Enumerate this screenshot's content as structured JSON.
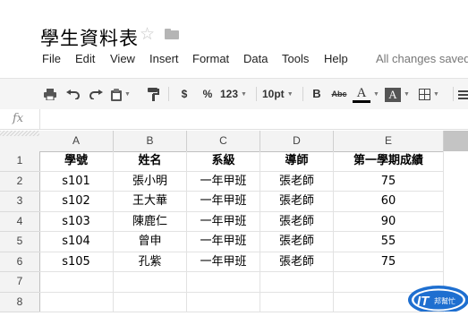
{
  "document": {
    "title": "學生資料表",
    "save_status": "All changes saved"
  },
  "menu": [
    "File",
    "Edit",
    "View",
    "Insert",
    "Format",
    "Data",
    "Tools",
    "Help"
  ],
  "toolbar": {
    "currency_label": "$",
    "percent_label": "%",
    "number_format_label": "123",
    "font_size_label": "10pt",
    "bold_label": "B",
    "strikethrough_label": "Abc",
    "text_color_label": "A",
    "fill_color_label": "A",
    "text_color_value": "#000000"
  },
  "formula_bar": {
    "fx_label": "fx",
    "value": ""
  },
  "sheet": {
    "columns": [
      "A",
      "B",
      "C",
      "D",
      "E"
    ],
    "row_numbers": [
      "1",
      "2",
      "3",
      "4",
      "5",
      "6",
      "7",
      "8"
    ],
    "rows": [
      [
        "學號",
        "姓名",
        "系級",
        "導師",
        "第一學期成績"
      ],
      [
        "s101",
        "張小明",
        "一年甲班",
        "張老師",
        "75"
      ],
      [
        "s102",
        "王大華",
        "一年甲班",
        "張老師",
        "60"
      ],
      [
        "s103",
        "陳鹿仁",
        "一年甲班",
        "張老師",
        "90"
      ],
      [
        "s104",
        "曾申",
        "一年甲班",
        "張老師",
        "55"
      ],
      [
        "s105",
        "孔紫",
        "一年甲班",
        "張老師",
        "75"
      ],
      [
        "",
        "",
        "",
        "",
        ""
      ],
      [
        "",
        "",
        "",
        "",
        ""
      ]
    ]
  },
  "watermark": {
    "logo_text": "IT",
    "logo_subtext": "邦幫忙"
  },
  "colors": {
    "toolbar_bg": "#f5f5f5",
    "header_bg": "#f3f3f3",
    "logo_blue": "#1e6fd0"
  }
}
